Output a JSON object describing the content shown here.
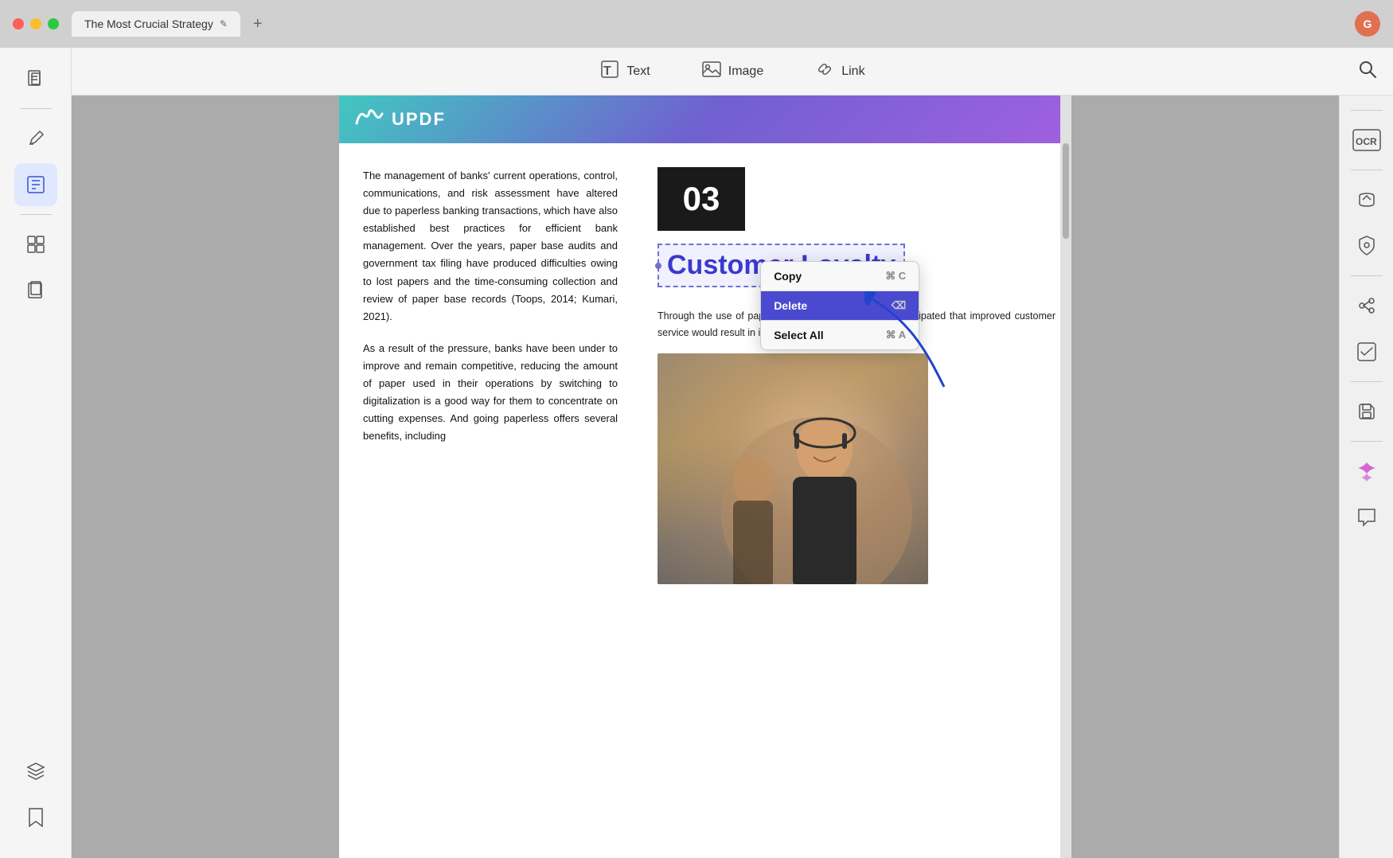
{
  "titlebar": {
    "tab_label": "The Most Crucial Strategy",
    "tab_edit_icon": "✎",
    "tab_add": "+",
    "avatar_letter": "G"
  },
  "toolbar": {
    "text_label": "Text",
    "image_label": "Image",
    "link_label": "Link",
    "search_icon": "🔍"
  },
  "sidebar_left": {
    "items": [
      {
        "name": "pages-icon",
        "icon": "▦",
        "active": false
      },
      {
        "name": "annotate-icon",
        "icon": "✏️",
        "active": false
      },
      {
        "name": "edit-icon",
        "icon": "✏",
        "active": true
      },
      {
        "name": "organize-icon",
        "icon": "⊞",
        "active": false
      },
      {
        "name": "compress-icon",
        "icon": "❐",
        "active": false
      },
      {
        "name": "layers-icon",
        "icon": "◫",
        "active": false
      },
      {
        "name": "bookmark-icon",
        "icon": "🔖",
        "active": false
      }
    ]
  },
  "sidebar_right": {
    "items": [
      {
        "name": "search-right-icon",
        "icon": "⌕"
      },
      {
        "name": "ocr-icon",
        "icon": "▦"
      },
      {
        "name": "convert-icon",
        "icon": "↻"
      },
      {
        "name": "secure-icon",
        "icon": "🔒"
      },
      {
        "name": "share-icon",
        "icon": "↗"
      },
      {
        "name": "check-icon",
        "icon": "☑"
      },
      {
        "name": "save-icon",
        "icon": "💾"
      },
      {
        "name": "ai-icon",
        "icon": "✦"
      },
      {
        "name": "chat-icon",
        "icon": "💬"
      }
    ]
  },
  "pdf": {
    "logo_text": "UPDF",
    "number": "03",
    "heading": "Customer Loyalty",
    "para1": "The management of banks' current operations, control, communications, and risk assessment have altered due to paperless banking transactions, which have also established best practices for efficient bank management. Over the years, paper base audits and government tax filing have produced difficulties owing to lost papers and the time-consuming collection and review of paper base records (Toops, 2014; Kumari, 2021).",
    "para2": "As a result of the pressure, banks have been under to improve and remain competitive, reducing the amount of paper used in their operations by switching to digitalization is a good way for them to concentrate on cutting expenses. And going paperless offers several benefits, including",
    "body_text": "Through the use of paperless banking methods, it is anticipated that improved customer service would result in increased customer loyalty."
  },
  "context_menu": {
    "copy_label": "Copy",
    "copy_shortcut": "⌘ C",
    "delete_label": "Delete",
    "delete_icon": "⌫",
    "select_all_label": "Select All",
    "select_all_shortcut": "⌘ A"
  }
}
